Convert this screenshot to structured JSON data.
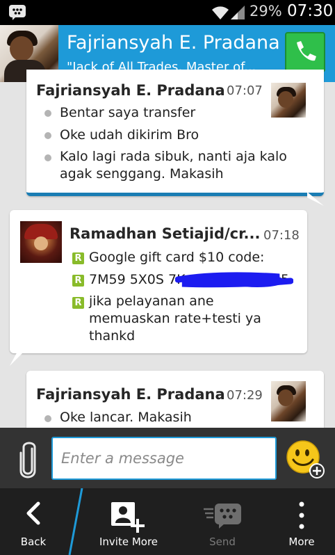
{
  "status_bar": {
    "battery": "29%",
    "time": "07:30"
  },
  "header": {
    "contact_name": "Fajriansyah E. Pradana",
    "contact_status": "\"Jack of All Trades, Master of..."
  },
  "messages": [
    {
      "sender": "Fajriansyah E. Pradana",
      "time": "07:07",
      "lines": [
        "Bentar saya transfer",
        "Oke udah dikirim Bro",
        "Kalo lagi rada sibuk, nanti aja kalo agak senggang. Makasih"
      ]
    },
    {
      "sender": "Ramadhan Setiajid/cr...",
      "time": "07:18",
      "lines": [
        "Google gift card $10 code:",
        "7M59 5X0S 7K",
        "jika pelayanan ane memuaskan rate+testi ya thankd"
      ],
      "redacted_tail": "5"
    },
    {
      "sender": "Fajriansyah E. Pradana",
      "time": "07:29",
      "lines": [
        "Oke lancar. Makasih"
      ]
    }
  ],
  "composer": {
    "placeholder": "Enter a message"
  },
  "action_bar": {
    "back": "Back",
    "invite_more": "Invite More",
    "send": "Send",
    "more": "More"
  },
  "colors": {
    "accent": "#1e9ad8",
    "bbm_badge": "#89bb2a",
    "call_green": "#2fbf4a"
  },
  "icons": {
    "bbm": "bbm-icon",
    "wifi": "wifi-icon",
    "signal": "signal-icon",
    "call": "phone-icon",
    "attach": "paperclip-icon",
    "emoticon": "smiley-add-icon",
    "back": "chevron-left-icon",
    "invite": "add-person-icon",
    "send": "bbm-send-icon",
    "more": "overflow-icon"
  }
}
